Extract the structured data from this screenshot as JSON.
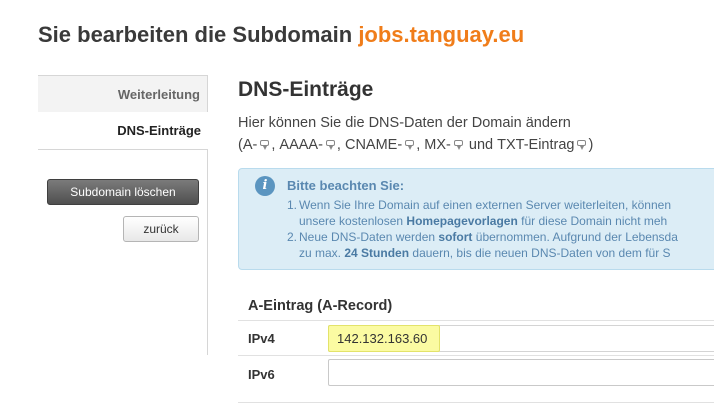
{
  "header": {
    "title_prefix": "Sie bearbeiten die Subdomain",
    "domain": "jobs.tanguay.eu"
  },
  "sidebar": {
    "tabs": [
      {
        "label": "Weiterleitung",
        "active": false
      },
      {
        "label": "DNS-Einträge",
        "active": true
      }
    ],
    "delete_button": "Subdomain löschen",
    "back_button": "zurück"
  },
  "main": {
    "title": "DNS-Einträge",
    "description_line1": "Hier können Sie die DNS-Daten der Domain ändern",
    "record_types": [
      "A-",
      "AAAA-",
      "CNAME-",
      "MX-",
      "TXT-Eintrag"
    ],
    "desc_open": "(",
    "desc_sep": ",",
    "desc_and": "und",
    "desc_close": ")",
    "notice": {
      "title": "Bitte beachten Sie:",
      "item1_num": "1.",
      "item1_line1": "Wenn Sie Ihre Domain auf einen externen Server weiterleiten, können",
      "item1_line2_a": "unsere kostenlosen",
      "item1_line2_b": "Homepagevorlagen",
      "item1_line2_c": "für diese Domain nicht meh",
      "item2_num": "2.",
      "item2_line1_a": "Neue DNS-Daten werden",
      "item2_line1_b": "sofort",
      "item2_line1_c": "übernommen. Aufgrund der Lebensda",
      "item2_line2_a": "zu max.",
      "item2_line2_b": "24 Stunden",
      "item2_line2_c": "dauern, bis die neuen DNS-Daten von dem für S"
    },
    "record": {
      "title": "A-Eintrag (A-Record)",
      "ipv4_label": "IPv4",
      "ipv4_value": "142.132.163.60",
      "ipv6_label": "IPv6",
      "ipv6_value": ""
    }
  },
  "colors": {
    "accent": "#f07d1a",
    "notice_bg": "#dcedf6",
    "notice_text": "#5a88b0",
    "highlight": "#fbfba2"
  }
}
